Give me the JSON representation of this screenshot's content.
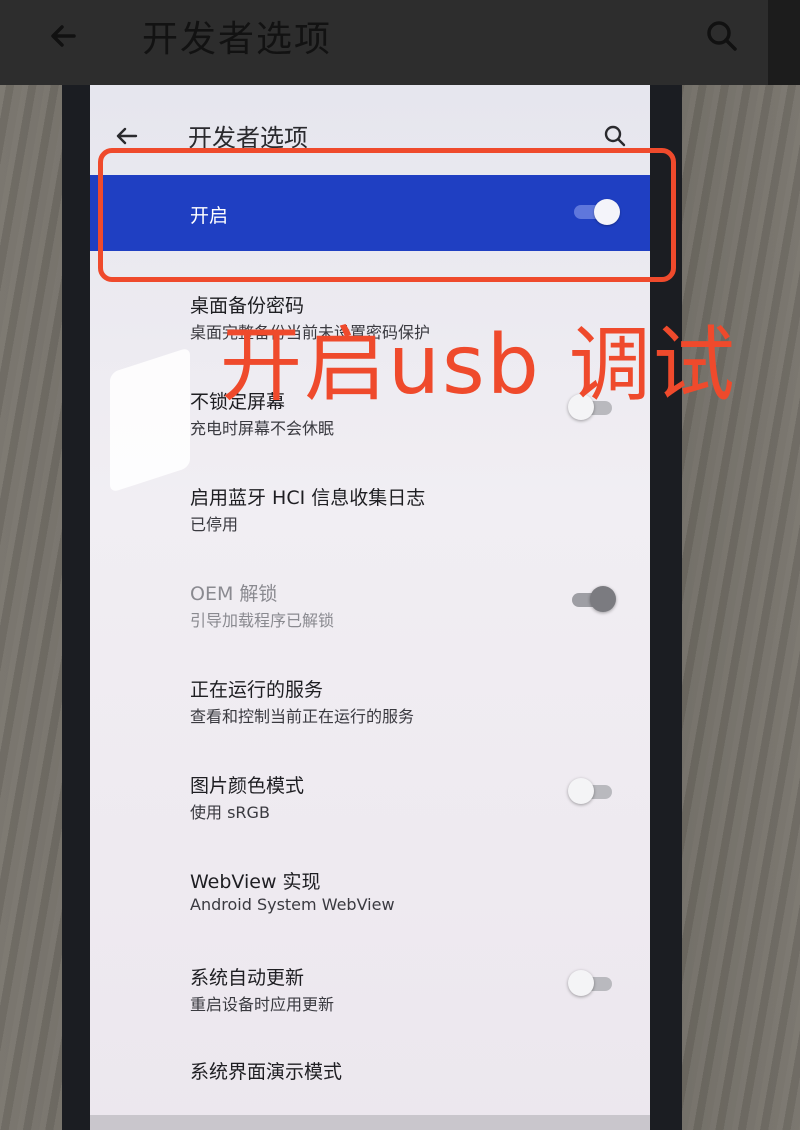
{
  "app_bar": {
    "title": "开发者选项",
    "icons": [
      "back-arrow-icon",
      "search-icon"
    ]
  },
  "screen": {
    "title": "开发者选项",
    "master_toggle": {
      "label": "开启",
      "on": true
    },
    "items": [
      {
        "title": "桌面备份密码",
        "subtitle": "桌面完整备份当前未设置密码保护"
      },
      {
        "title": "不锁定屏幕",
        "subtitle": "充电时屏幕不会休眠",
        "toggle": false
      },
      {
        "title": "启用蓝牙 HCI 信息收集日志",
        "subtitle": "已停用"
      },
      {
        "title": "OEM 解锁",
        "subtitle": "引导加载程序已解锁",
        "toggle": true,
        "disabled": true
      },
      {
        "title": "正在运行的服务",
        "subtitle": "查看和控制当前正在运行的服务"
      },
      {
        "title": "图片颜色模式",
        "subtitle": "使用 sRGB",
        "toggle": false
      },
      {
        "title": "WebView 实现",
        "subtitle": "Android System WebView"
      },
      {
        "title": "系统自动更新",
        "subtitle": "重启设备时应用更新",
        "toggle": false
      },
      {
        "title": "系统界面演示模式"
      }
    ]
  },
  "annotation": {
    "text": "开启usb 调试",
    "color": "#ef4a2c"
  },
  "colors": {
    "accent": "#1f3fc2",
    "annotation": "#ef4a2c"
  }
}
